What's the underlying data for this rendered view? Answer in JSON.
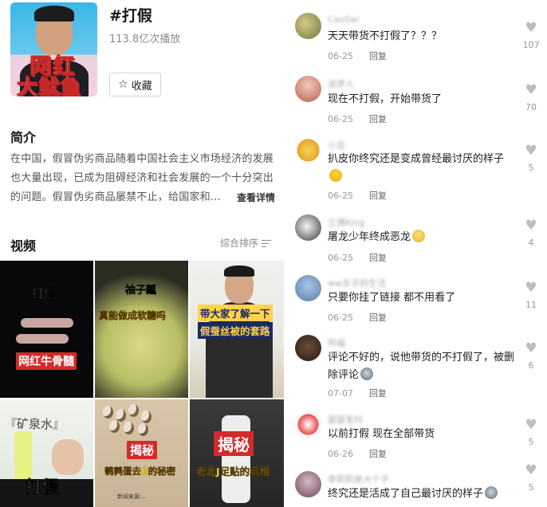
{
  "topic": {
    "title": "#打假",
    "plays": "113.8亿次播放",
    "favorite_label": "收藏",
    "cover_text_line1": "网红",
    "cover_text_line2": "大鱿鱼"
  },
  "intro": {
    "heading": "简介",
    "text": "在中国，假冒伪劣商品随着中国社会主义市场经济的发展也大量出现，已成为阻碍经济和社会发展的一个十分突出的问题。假冒伪劣商品屡禁不止，给国家和...",
    "more_label": "查看详情"
  },
  "videos": {
    "heading": "视频",
    "sort_label": "综合排序",
    "tiles": [
      {
        "caption1": "打假",
        "caption2": "网红牛骨髓"
      },
      {
        "caption1": "柚子瓤",
        "caption2": "真能做成软糖吗"
      },
      {
        "caption1": "带大家了解一下",
        "caption2": "假蚕丝被的套路"
      },
      {
        "caption1": "『矿泉水』",
        "caption2": "打假"
      },
      {
        "caption1": "揭秘",
        "caption2": "鹌鹑蛋去B的秘密",
        "caption3": "新闻来源:..."
      },
      {
        "caption1": "揭秘",
        "caption2": "老北J足贴的真相"
      }
    ]
  },
  "comments": [
    {
      "user": "CaoSar",
      "text": "天天带货不打假了？？？",
      "date": "06-25",
      "reply": "回复",
      "likes": "107"
    },
    {
      "user": "追梦人",
      "text": "现在不打假，开始带货了",
      "date": "06-25",
      "reply": "回复",
      "likes": "70"
    },
    {
      "user": "小丑",
      "text": "扒皮你终究还是变成曾经最讨厌的样子",
      "date": "06-25",
      "reply": "回复",
      "likes": "5"
    },
    {
      "user": "兰博King",
      "text": "屠龙少年终成恶龙",
      "date": "06-25",
      "reply": "回复",
      "likes": "4"
    },
    {
      "user": "ww东子的生活",
      "text": "只要你挂了链接 都不用看了",
      "date": "06-25",
      "reply": "回复",
      "likes": "11"
    },
    {
      "user": "阿福",
      "text": "评论不好的，说他带货的不打假了，被删除评论",
      "date": "07-07",
      "reply": "回复",
      "likes": "6"
    },
    {
      "user": "瑟瑟发抖",
      "text": "以前打假 现在全部带货",
      "date": "06-26",
      "reply": "回复",
      "likes": "5"
    },
    {
      "user": "李莉莉是大个子",
      "text": "终究还是活成了自己最讨厌的样子",
      "date": "",
      "reply": "",
      "likes": "5"
    }
  ]
}
